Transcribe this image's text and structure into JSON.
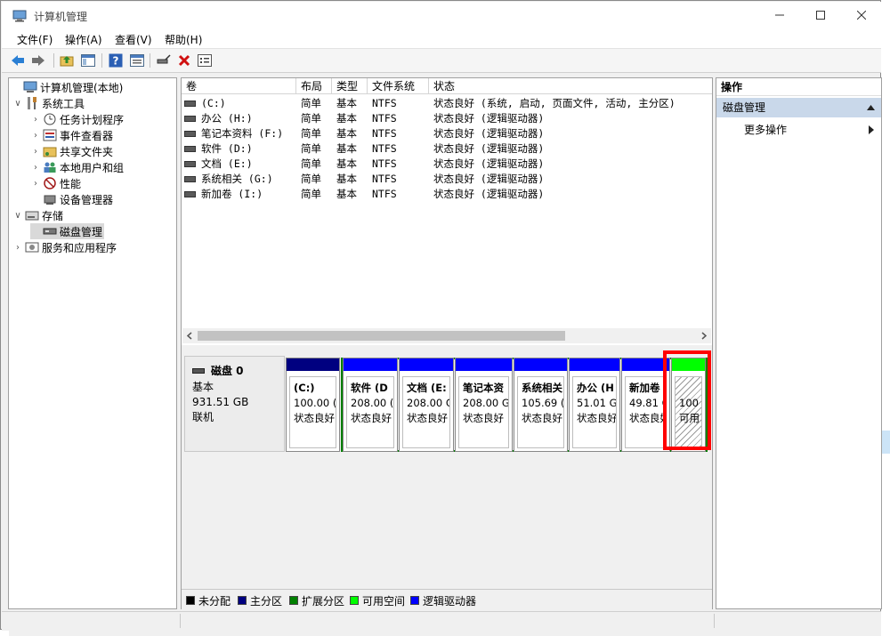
{
  "window": {
    "title": "计算机管理"
  },
  "menu": [
    "文件(F)",
    "操作(A)",
    "查看(V)",
    "帮助(H)"
  ],
  "tree": {
    "root": "计算机管理(本地)",
    "system_tools": "系统工具",
    "task_scheduler": "任务计划程序",
    "event_viewer": "事件查看器",
    "shared_folders": "共享文件夹",
    "local_users": "本地用户和组",
    "performance": "性能",
    "device_manager": "设备管理器",
    "storage": "存储",
    "disk_management": "磁盘管理",
    "services_apps": "服务和应用程序"
  },
  "volumes_table": {
    "headers": [
      "卷",
      "布局",
      "类型",
      "文件系统",
      "状态"
    ],
    "rows": [
      {
        "name": "(C:)",
        "layout": "简单",
        "type": "基本",
        "fs": "NTFS",
        "status": "状态良好 (系统, 启动, 页面文件, 活动, 主分区)"
      },
      {
        "name": "办公 (H:)",
        "layout": "简单",
        "type": "基本",
        "fs": "NTFS",
        "status": "状态良好 (逻辑驱动器)"
      },
      {
        "name": "笔记本资料 (F:)",
        "layout": "简单",
        "type": "基本",
        "fs": "NTFS",
        "status": "状态良好 (逻辑驱动器)"
      },
      {
        "name": "软件 (D:)",
        "layout": "简单",
        "type": "基本",
        "fs": "NTFS",
        "status": "状态良好 (逻辑驱动器)"
      },
      {
        "name": "文档 (E:)",
        "layout": "简单",
        "type": "基本",
        "fs": "NTFS",
        "status": "状态良好 (逻辑驱动器)"
      },
      {
        "name": "系统相关 (G:)",
        "layout": "简单",
        "type": "基本",
        "fs": "NTFS",
        "status": "状态良好 (逻辑驱动器)"
      },
      {
        "name": "新加卷 (I:)",
        "layout": "简单",
        "type": "基本",
        "fs": "NTFS",
        "status": "状态良好 (逻辑驱动器)"
      }
    ]
  },
  "disk": {
    "name": "磁盘 0",
    "kind": "基本",
    "size": "931.51 GB",
    "state": "联机",
    "partitions": [
      {
        "name": "(C:)",
        "size": "100.00 (",
        "status": "状态良好"
      },
      {
        "name": "软件 (D",
        "size": "208.00 (",
        "status": "状态良好"
      },
      {
        "name": "文档 (E:",
        "size": "208.00 G",
        "status": "状态良好"
      },
      {
        "name": "笔记本资",
        "size": "208.00 G",
        "status": "状态良好"
      },
      {
        "name": "系统相关",
        "size": "105.69 (",
        "status": "状态良好"
      },
      {
        "name": "办公 (H",
        "size": "51.01 G",
        "status": "状态良好"
      },
      {
        "name": "新加卷",
        "size": "49.81 G",
        "status": "状态良好"
      },
      {
        "name": "",
        "size": "100",
        "status": "可用"
      }
    ]
  },
  "legend": [
    "未分配",
    "主分区",
    "扩展分区",
    "可用空间",
    "逻辑驱动器"
  ],
  "actions": {
    "header": "操作",
    "section": "磁盘管理",
    "more": "更多操作"
  },
  "colors": {
    "primary": "#000080",
    "logical": "#0000ff",
    "extended": "#008000",
    "free": "#00ff00",
    "unallocated": "#000000",
    "highlight": "#ff0000"
  }
}
